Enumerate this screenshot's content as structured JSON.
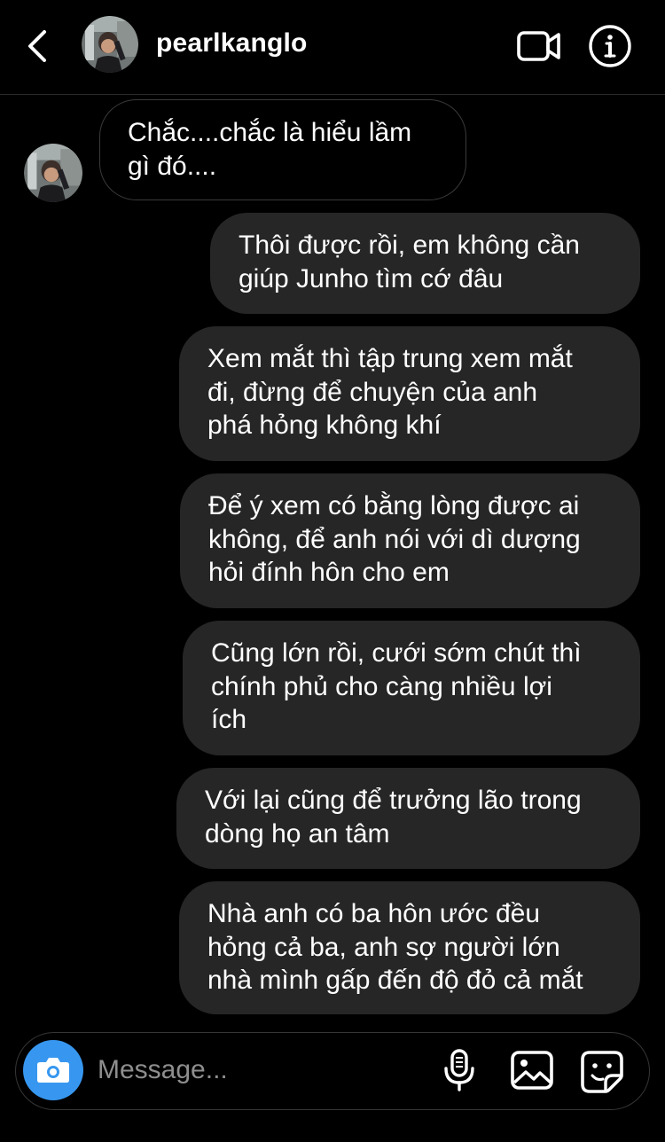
{
  "header": {
    "username": "pearlkanglo",
    "back_icon": "chevron-left-icon",
    "video_icon": "video-camera-icon",
    "info_icon": "info-icon"
  },
  "thread": {
    "received": [
      {
        "text": "Chắc....chắc là hiểu lầm\ngì đó...."
      }
    ],
    "sent": [
      {
        "text": "Thôi được rồi, em không cần\ngiúp Junho tìm cớ đâu"
      },
      {
        "text": "Xem mắt thì tập trung xem mắt\nđi, đừng để chuyện của anh\nphá hỏng không khí"
      },
      {
        "text": "Để ý xem có bằng lòng được ai\nkhông, để anh nói với dì dượng\nhỏi đính hôn cho em"
      },
      {
        "text": "Cũng lớn rồi, cưới sớm chút thì\nchính phủ cho càng nhiều lợi\ních"
      },
      {
        "text": "Với lại cũng để trưởng lão trong\ndòng họ an tâm"
      },
      {
        "text": "Nhà anh có ba hôn ước đều\nhỏng cả ba, anh sợ người lớn\nnhà mình gấp đến độ đỏ cả mắt"
      }
    ]
  },
  "composer": {
    "placeholder": "Message...",
    "camera_icon": "camera-icon",
    "mic_icon": "microphone-icon",
    "gallery_icon": "image-gallery-icon",
    "sticker_icon": "sticker-icon"
  },
  "colors": {
    "background": "#000000",
    "sent_bubble": "#262626",
    "received_border": "#3a3a3a",
    "accent_camera": "#3797f0",
    "placeholder": "#8e8e8e"
  }
}
